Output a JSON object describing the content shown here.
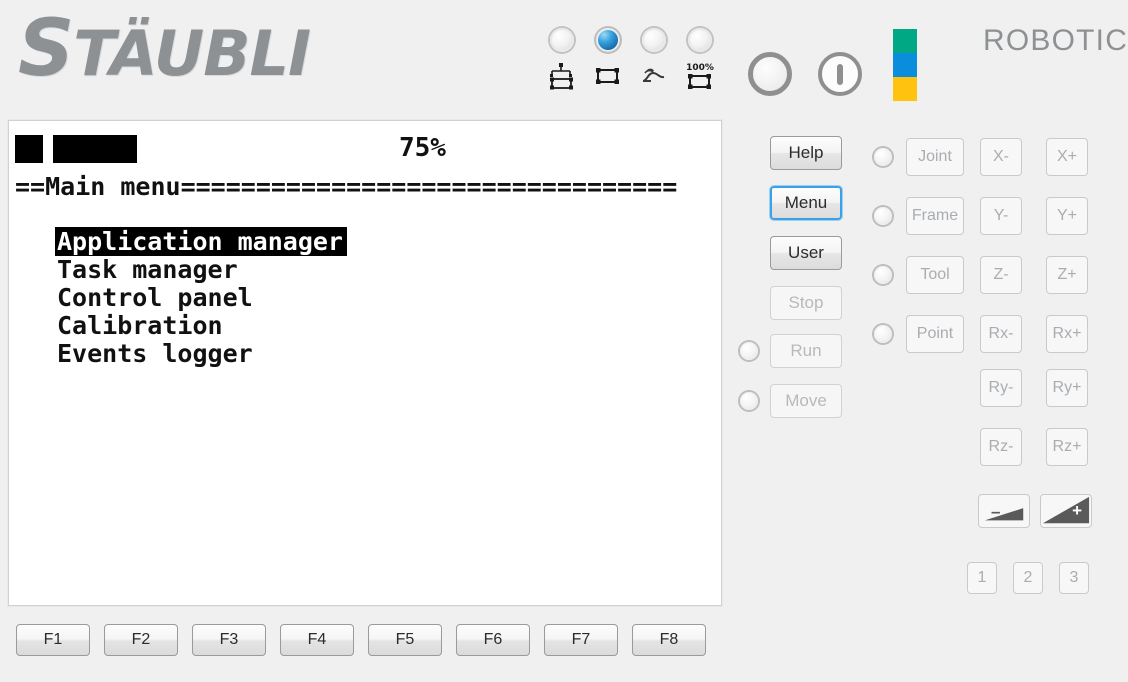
{
  "header": {
    "logo_text": "STÄUBLI",
    "brand_word": "ROBOTICS",
    "brand_colors": [
      "#00a984",
      "#0a8ddd",
      "#ffc20e"
    ],
    "estop_name": "emergency-stop-indicator",
    "power_name": "power-button",
    "mode_leds": [
      {
        "label": "remote-mode-led",
        "state": "off"
      },
      {
        "label": "local-mode-led",
        "state": "on"
      },
      {
        "label": "manual-mode-led",
        "state": "off"
      },
      {
        "label": "full-speed-mode-led",
        "state": "off"
      }
    ],
    "mode_icons": [
      {
        "name": "network-mode-icon",
        "caption": ""
      },
      {
        "name": "local-mode-icon",
        "caption": ""
      },
      {
        "name": "manual-hand-icon",
        "caption": ""
      },
      {
        "name": "full-speed-icon",
        "caption": "100%"
      }
    ]
  },
  "screen": {
    "speed_percent": "75%",
    "title_line": "==Main menu=================================",
    "menu_items": [
      {
        "label": "Application manager",
        "selected": true
      },
      {
        "label": "Task manager",
        "selected": false
      },
      {
        "label": "Control panel",
        "selected": false
      },
      {
        "label": "Calibration",
        "selected": false
      },
      {
        "label": "Events logger",
        "selected": false
      }
    ]
  },
  "actions": [
    {
      "label": "Help",
      "state": "enabled",
      "led": null
    },
    {
      "label": "Menu",
      "state": "focused",
      "led": null
    },
    {
      "label": "User",
      "state": "enabled",
      "led": null
    },
    {
      "label": "Stop",
      "state": "disabled",
      "led": null
    },
    {
      "label": "Run",
      "state": "disabled",
      "led": "off"
    },
    {
      "label": "Move",
      "state": "disabled",
      "led": "off"
    }
  ],
  "jog": {
    "modes": [
      {
        "label": "Joint",
        "led": "off"
      },
      {
        "label": "Frame",
        "led": "off"
      },
      {
        "label": "Tool",
        "led": "off"
      },
      {
        "label": "Point",
        "led": "off"
      }
    ],
    "axes": [
      {
        "neg": "X-",
        "pos": "X+"
      },
      {
        "neg": "Y-",
        "pos": "Y+"
      },
      {
        "neg": "Z-",
        "pos": "Z+"
      },
      {
        "neg": "Rx-",
        "pos": "Rx+"
      },
      {
        "neg": "Ry-",
        "pos": "Ry+"
      },
      {
        "neg": "Rz-",
        "pos": "Rz+"
      }
    ],
    "speed_down_sign": "–",
    "speed_up_sign": "+",
    "numeric_keys": [
      "1",
      "2",
      "3"
    ]
  },
  "function_keys": [
    "F1",
    "F2",
    "F3",
    "F4",
    "F5",
    "F6",
    "F7",
    "F8"
  ]
}
